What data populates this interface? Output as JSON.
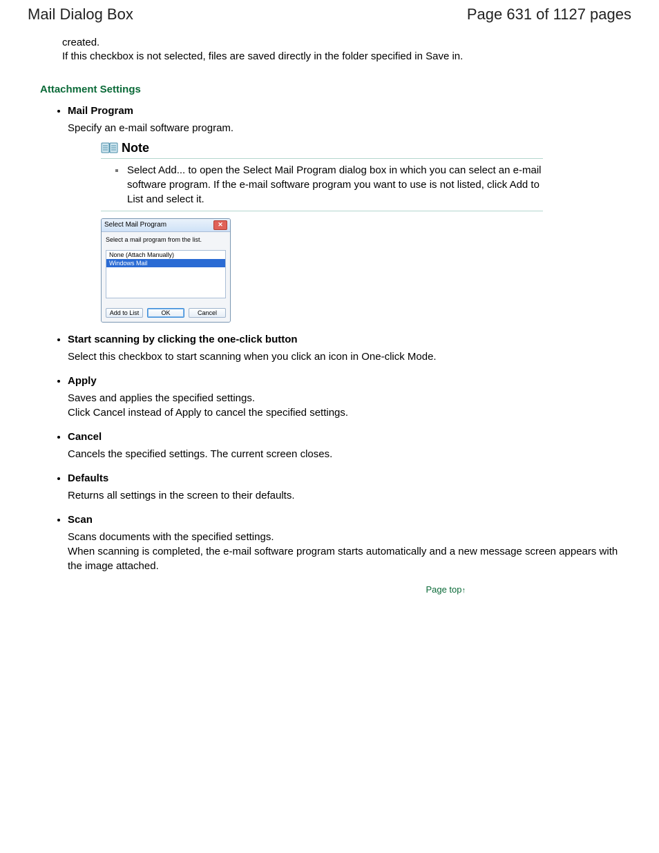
{
  "header": {
    "title": "Mail Dialog Box",
    "page_label": "Page 631 of 1127 pages"
  },
  "intro": {
    "line1": "created.",
    "line2": "If this checkbox is not selected, files are saved directly in the folder specified in Save in."
  },
  "section_heading": "Attachment Settings",
  "items": [
    {
      "title": "Mail Program",
      "body": "Specify an e-mail software program."
    },
    {
      "title": "Start scanning by clicking the one-click button",
      "body": "Select this checkbox to start scanning when you click an icon in One-click Mode."
    },
    {
      "title": "Apply",
      "body": "Saves and applies the specified settings.\nClick Cancel instead of Apply to cancel the specified settings."
    },
    {
      "title": "Cancel",
      "body": "Cancels the specified settings. The current screen closes."
    },
    {
      "title": "Defaults",
      "body": "Returns all settings in the screen to their defaults."
    },
    {
      "title": "Scan",
      "body": "Scans documents with the specified settings.\nWhen scanning is completed, the e-mail software program starts automatically and a new message screen appears with the image attached."
    }
  ],
  "note": {
    "label": "Note",
    "text": "Select Add... to open the Select Mail Program dialog box in which you can select an e-mail software program. If the e-mail software program you want to use is not listed, click Add to List and select it."
  },
  "dialog": {
    "title": "Select Mail Program",
    "close_glyph": "✕",
    "instruction": "Select a mail program from the list.",
    "rows": [
      "None (Attach Manually)",
      "Windows Mail"
    ],
    "buttons": {
      "add": "Add to List",
      "ok": "OK",
      "cancel": "Cancel"
    }
  },
  "page_top": {
    "label": "Page top",
    "arrow": "↑"
  }
}
